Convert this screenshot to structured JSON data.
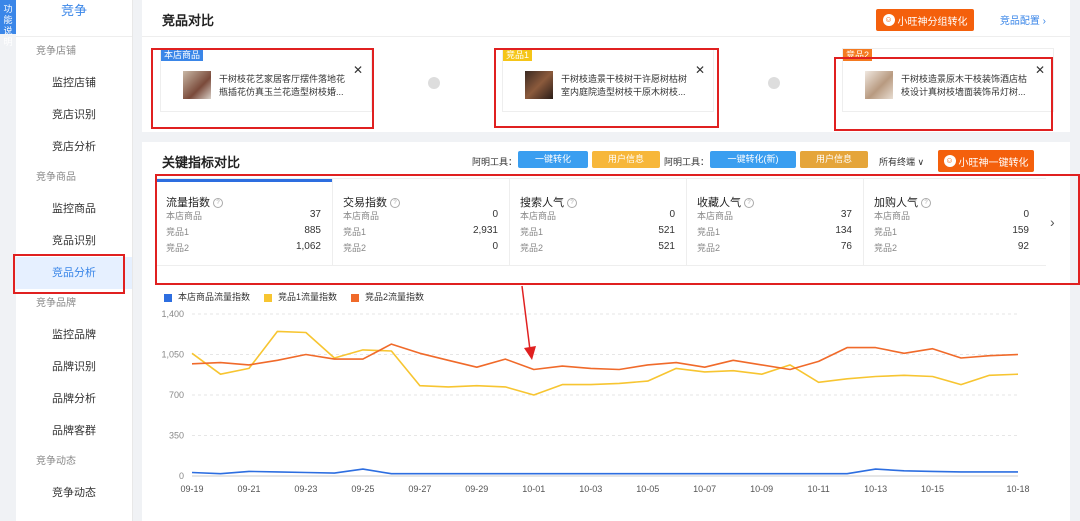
{
  "left_tab": {
    "line1": "功能",
    "line2": "说明"
  },
  "sidebar": {
    "title": "竞争",
    "groups": [
      {
        "label": "竞争店铺",
        "items": [
          "监控店铺",
          "竞店识别",
          "竞店分析"
        ]
      },
      {
        "label": "竞争商品",
        "items": [
          "监控商品",
          "竞品识别",
          "竞品分析"
        ]
      },
      {
        "label": "竞争品牌",
        "items": [
          "监控品牌",
          "品牌识别",
          "品牌分析",
          "品牌客群"
        ]
      },
      {
        "label": "竞争动态",
        "items": [
          "竞争动态"
        ]
      }
    ],
    "active_item": "竞品分析"
  },
  "compare": {
    "title": "竞品对比",
    "ai_button": "小旺神分组转化",
    "config_link": "竞品配置 ›",
    "products": [
      {
        "tag": "本店商品",
        "tag_color": "#3a86e8",
        "name": "干树枝花艺家居客厅摆件落地花瓶插花仿真玉兰花造型树枝婚...",
        "close": "✕"
      },
      {
        "tag": "竞品1",
        "tag_color": "#f5c518",
        "name": "干树枝造景干枝树干许愿树枯树室内庭院造型树枝干原木树枝...",
        "close": "✕"
      },
      {
        "tag": "竞品2",
        "tag_color": "#f47a20",
        "name": "干树枝造景原木干枝装饰酒店枯枝设计真树枝墙面装饰吊灯树...",
        "close": "✕"
      }
    ]
  },
  "key_metrics": {
    "title": "关键指标对比",
    "tool_label_1": "阿明工具：",
    "btn_convert": "一键转化",
    "btn_user_info_1": "用户信息",
    "tool_label_2": "阿明工具：",
    "btn_convert_new": "一键转化(新)",
    "btn_user_info_2": "用户信息",
    "terminal": "所有终端 ∨",
    "ai_button": "小旺神一键转化",
    "row_labels": [
      "本店商品",
      "竞品1",
      "竞品2"
    ],
    "metrics": [
      {
        "title": "流量指数",
        "values": [
          "37",
          "885",
          "1,062"
        ]
      },
      {
        "title": "交易指数",
        "values": [
          "0",
          "2,931",
          "0"
        ]
      },
      {
        "title": "搜索人气",
        "values": [
          "0",
          "521",
          "521"
        ]
      },
      {
        "title": "收藏人气",
        "values": [
          "37",
          "134",
          "76"
        ]
      },
      {
        "title": "加购人气",
        "values": [
          "0",
          "159",
          "92"
        ]
      }
    ],
    "next": "›"
  },
  "chart_data": {
    "type": "line",
    "x": [
      "09-19",
      "09-20",
      "09-21",
      "09-22",
      "09-23",
      "09-24",
      "09-25",
      "09-26",
      "09-27",
      "09-28",
      "09-29",
      "09-30",
      "10-01",
      "10-02",
      "10-03",
      "10-04",
      "10-05",
      "10-06",
      "10-07",
      "10-08",
      "10-09",
      "10-10",
      "10-11",
      "10-12",
      "10-13",
      "10-14",
      "10-15",
      "10-16",
      "10-17",
      "10-18"
    ],
    "tick_labels": [
      "09-19",
      "09-21",
      "09-23",
      "09-25",
      "09-27",
      "09-29",
      "10-01",
      "10-03",
      "10-05",
      "10-07",
      "10-09",
      "10-11",
      "10-13",
      "10-15",
      "10-18"
    ],
    "y_ticks": [
      "0",
      "350",
      "700",
      "1,050",
      "1,400"
    ],
    "ylim": [
      0,
      1400
    ],
    "grid": true,
    "legend_position": "top-left",
    "series": [
      {
        "name": "本店商品流量指数",
        "color": "#2d6ee0",
        "values": [
          30,
          20,
          40,
          35,
          30,
          25,
          60,
          20,
          20,
          20,
          20,
          20,
          20,
          20,
          20,
          20,
          20,
          20,
          20,
          20,
          20,
          20,
          20,
          20,
          60,
          45,
          40,
          35,
          35,
          35
        ]
      },
      {
        "name": "竞品1流量指数",
        "color": "#f7c531",
        "values": [
          1060,
          880,
          930,
          1250,
          1240,
          1020,
          1090,
          1080,
          780,
          770,
          780,
          770,
          700,
          790,
          790,
          800,
          820,
          930,
          900,
          910,
          880,
          960,
          810,
          840,
          860,
          870,
          860,
          790,
          870,
          880
        ]
      },
      {
        "name": "竞品2流量指数",
        "color": "#f06a2a",
        "values": [
          970,
          980,
          960,
          1000,
          1050,
          1010,
          1010,
          1140,
          1060,
          1000,
          940,
          1010,
          920,
          950,
          930,
          920,
          960,
          980,
          940,
          1000,
          960,
          920,
          990,
          1110,
          1110,
          1060,
          1100,
          1020,
          1040,
          1050
        ]
      }
    ]
  }
}
